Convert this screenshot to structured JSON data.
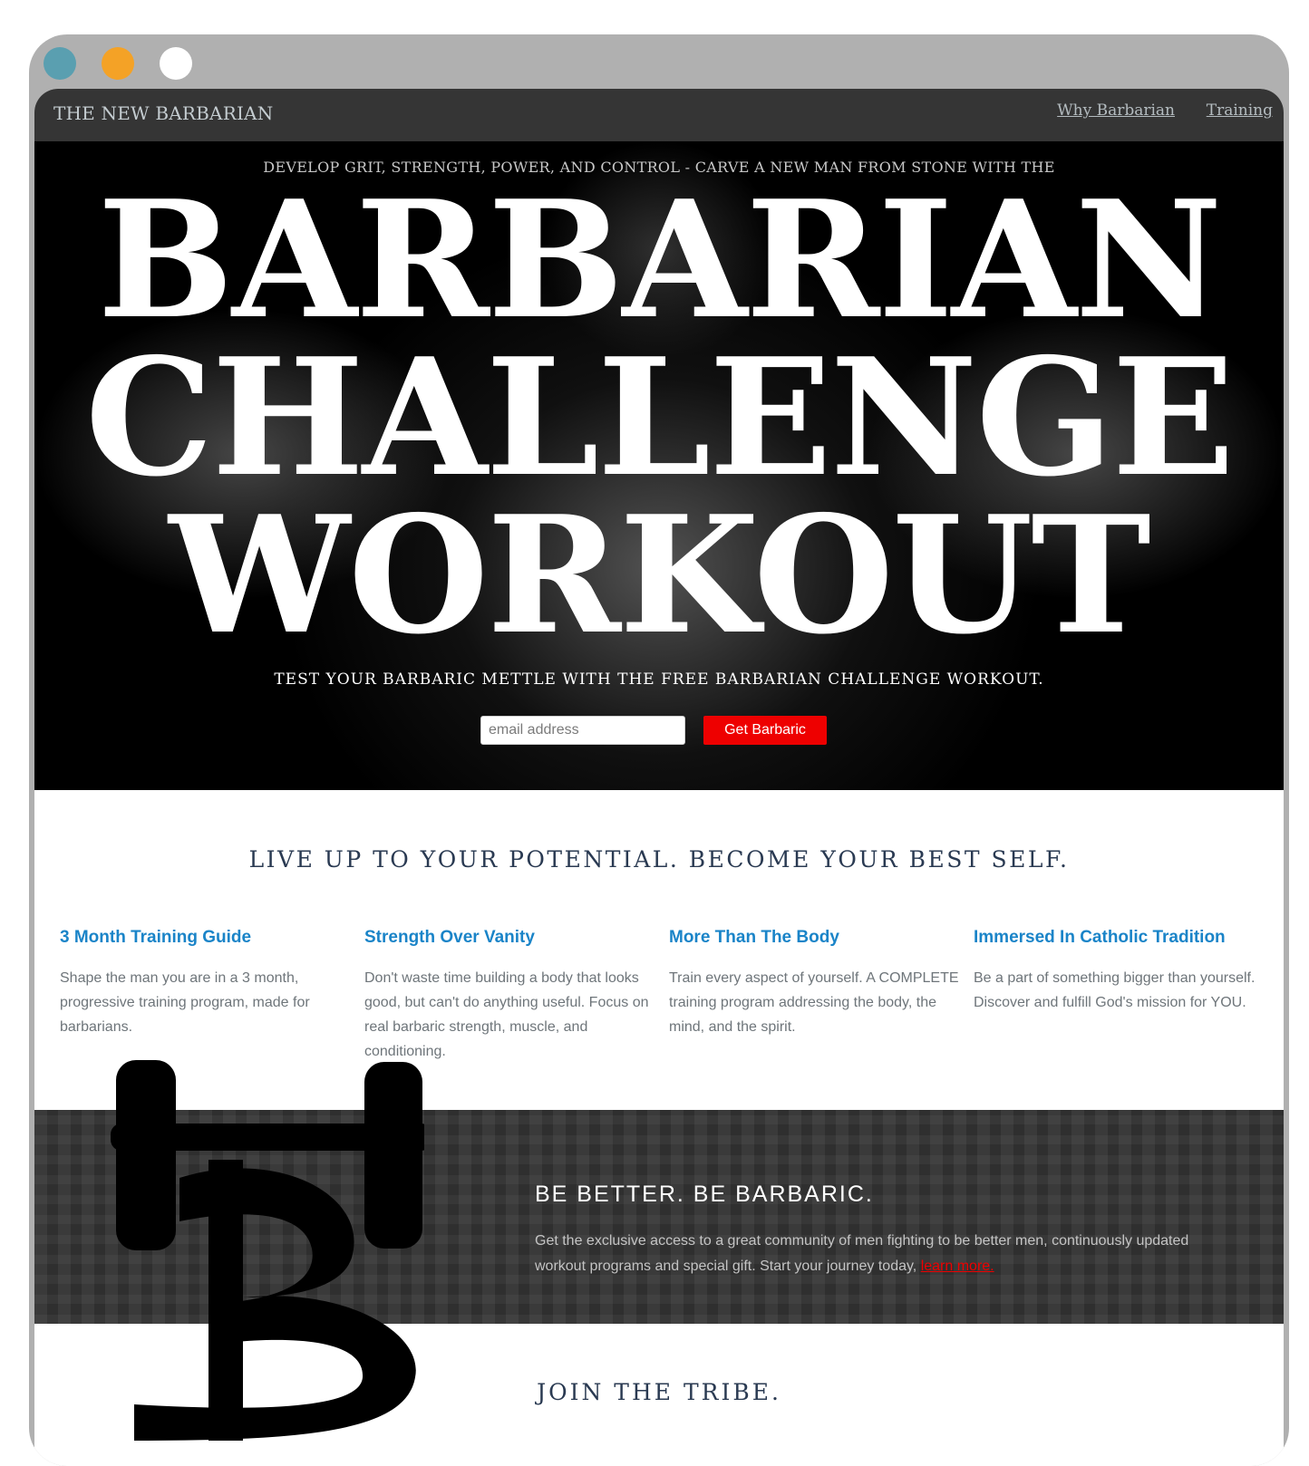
{
  "window": {
    "controls": [
      "close",
      "minimize",
      "maximize"
    ],
    "colors": {
      "close": "#5a9fb0",
      "minimize": "#f4a226",
      "maximize": "#ffffff"
    }
  },
  "nav": {
    "brand": "THE NEW BARBARIAN",
    "links": [
      "Why Barbarian",
      "Training"
    ]
  },
  "hero": {
    "kicker": "DEVELOP GRIT, STRENGTH, POWER, AND CONTROL - CARVE A NEW MAN FROM STONE WITH THE",
    "title_lines": [
      "BARBARIAN",
      "CHALLENGE",
      "WORKOUT"
    ],
    "subtitle": "TEST YOUR BARBARIC METTLE WITH THE FREE BARBARIAN CHALLENGE WORKOUT.",
    "email_placeholder": "email address",
    "email_value": "",
    "cta_label": "Get Barbaric"
  },
  "tagline": "LIVE UP TO YOUR POTENTIAL. BECOME YOUR BEST SELF.",
  "features": [
    {
      "title": "3 Month Training Guide",
      "text": "Shape the man you are in a 3 month, progressive training program, made for barbarians."
    },
    {
      "title": "Strength Over Vanity",
      "text": "Don't waste time building a body that looks good, but can't do anything useful. Focus on real barbaric strength, muscle, and conditioning."
    },
    {
      "title": "More Than The Body",
      "text": "Train every aspect of yourself. A COMPLETE training program addressing the body, the mind, and the spirit."
    },
    {
      "title": "Immersed In Catholic Tradition",
      "text": "Be a part of something bigger than yourself. Discover and fulfill God's mission for YOU."
    }
  ],
  "band": {
    "title": "BE BETTER. BE BARBARIC.",
    "text": "Get the exclusive access to a great community of men fighting to be better men, continuously updated workout programs and special gift. Start your journey today, ",
    "link": "learn more."
  },
  "join_heading": "JOIN THE TRIBE.",
  "colors": {
    "accent_red": "#ee0000",
    "link_blue": "#1a84c8",
    "heading_navy": "#2a3a52",
    "nav_bg": "#353535"
  },
  "icons": {
    "logo": "dumbbell-b-logo-icon"
  }
}
